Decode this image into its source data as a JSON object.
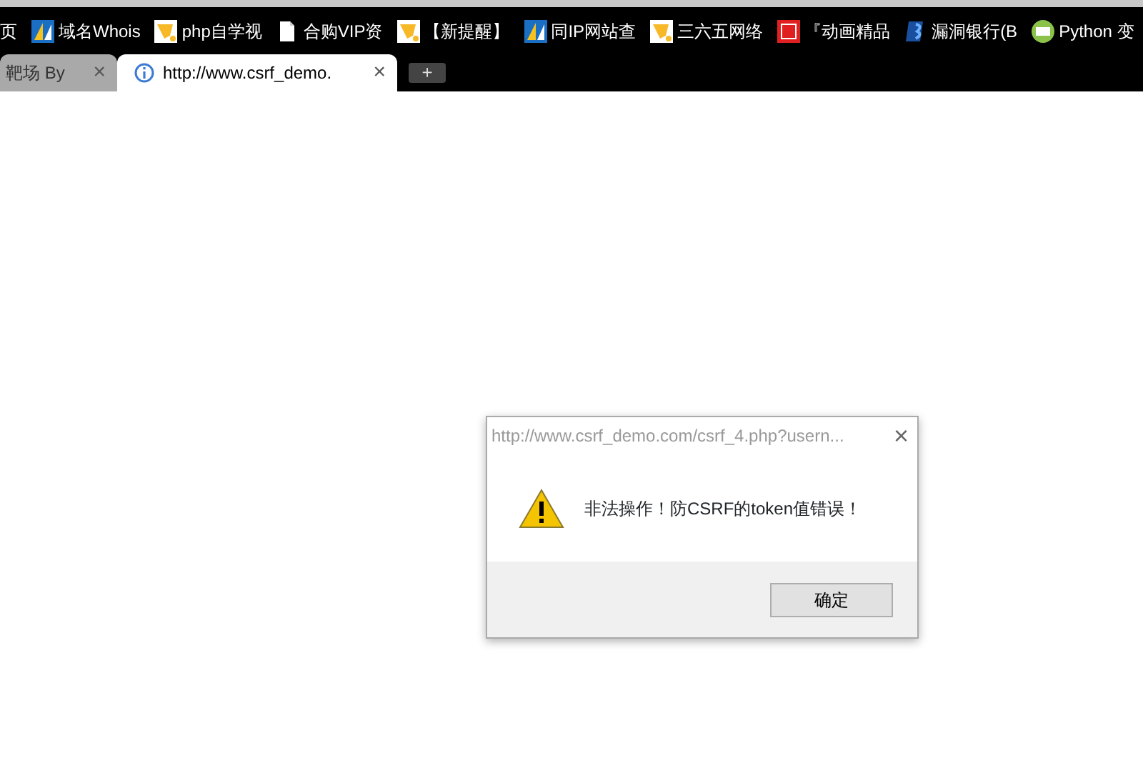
{
  "bookmarks": [
    {
      "label": "页",
      "kind": "none"
    },
    {
      "label": "域名Whois",
      "kind": "split"
    },
    {
      "label": "php自学视",
      "kind": "bell"
    },
    {
      "label": "合购VIP资",
      "kind": "page"
    },
    {
      "label": "【新提醒】",
      "kind": "bell"
    },
    {
      "label": "同IP网站查",
      "kind": "split"
    },
    {
      "label": "三六五网络",
      "kind": "bell"
    },
    {
      "label": "『动画精品",
      "kind": "seal"
    },
    {
      "label": "漏洞银行(B",
      "kind": "bank"
    },
    {
      "label": "Python 变",
      "kind": "python"
    }
  ],
  "tabs": [
    {
      "title": "靶场 By",
      "selected": false,
      "close": "×"
    },
    {
      "title": "http://www.csrf_demo.",
      "selected": true,
      "close": "×"
    }
  ],
  "new_tab": "+",
  "dialog": {
    "title": "http://www.csrf_demo.com/csrf_4.php?usern...",
    "close": "×",
    "message": "非法操作！防CSRF的token值错误！",
    "button": "确定"
  }
}
